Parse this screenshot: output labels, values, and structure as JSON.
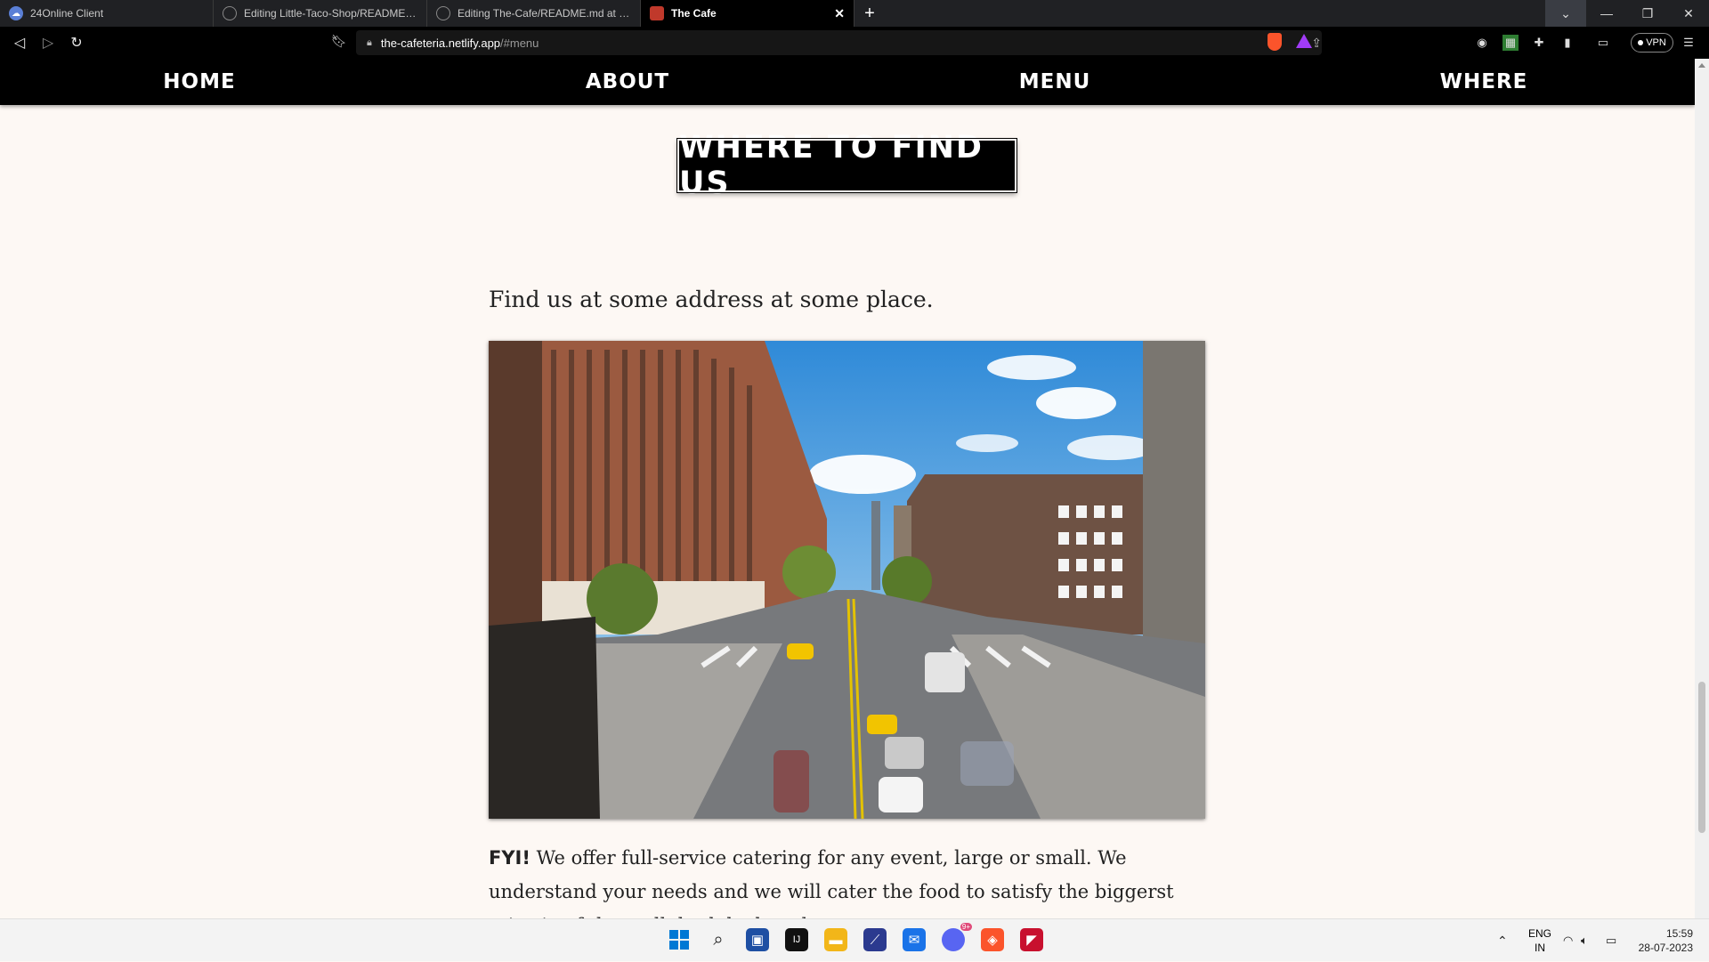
{
  "browser": {
    "tabs": [
      {
        "title": "24Online Client",
        "active": false,
        "favicon": "cloud-icon"
      },
      {
        "title": "Editing Little-Taco-Shop/README.md",
        "active": false,
        "favicon": "github-icon"
      },
      {
        "title": "Editing The-Cafe/README.md at main",
        "active": false,
        "favicon": "github-icon"
      },
      {
        "title": "The Cafe",
        "active": true,
        "favicon": "cafe-icon"
      }
    ],
    "new_tab": "+",
    "url_host": "the-cafeteria.netlify.app",
    "url_path": "/#menu",
    "vpn_label": "VPN"
  },
  "site": {
    "nav": [
      "HOME",
      "ABOUT",
      "MENU",
      "WHERE"
    ],
    "section_title": "WHERE TO FIND US",
    "lead": "Find us at some address at some place.",
    "photo_alt": "city street intersection",
    "fyi_label": "FYI!",
    "fyi_text": " We offer full-service catering for any event, large or small. We understand your needs and we will cater the food to satisfy the biggerst criteria of them all, both look and taste."
  },
  "taskbar": {
    "lang_top": "ENG",
    "lang_bottom": "IN",
    "time": "15:59",
    "date": "28-07-2023",
    "chat_badge": "9+"
  },
  "colors": {
    "page_bg": "#fdf8f4",
    "nav_bg": "#000000",
    "accent": "#fb542b"
  }
}
